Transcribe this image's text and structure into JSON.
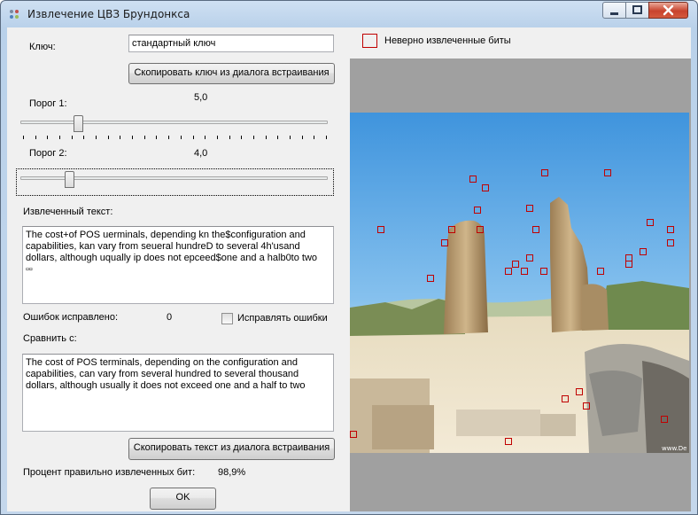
{
  "window": {
    "title": "Извлечение ЦВЗ Брундонкса"
  },
  "key": {
    "label": "Ключ:",
    "value": "стандартный ключ",
    "copy_button": "Скопировать ключ из диалога встраивания"
  },
  "threshold1": {
    "label": "Порог 1:",
    "value_text": "5,0",
    "level": 0.18
  },
  "threshold2": {
    "label": "Порог 2:",
    "value_text": "4,0",
    "level": 0.15
  },
  "extracted": {
    "label": "Извлеченный текст:",
    "text": "The cost+of POS uerminals, depending kn the$configuration and capabilities, kan vary from seueral hundreD to several 4h'usand dollars, although uqually ip does not epceed$one and a halb0to two    ▫▫"
  },
  "errors": {
    "label": "Ошибок исправлено:",
    "value": "0",
    "fix_checkbox_label": "Исправлять ошибки",
    "fix_checked": false
  },
  "compare": {
    "label": "Сравнить с:",
    "text": "The cost of POS terminals, depending on the configuration and capabilities, can vary from several hundred to several thousand dollars, although usually it does not exceed one and a half to two",
    "copy_button": "Скопировать текст из диалога встраивания"
  },
  "percent": {
    "label": "Процент правильно извлеченных бит:",
    "value": "98,9%"
  },
  "ok_button": "OK",
  "legend": {
    "label": "Неверно извлеченные биты",
    "color": "#c00000"
  },
  "image": {
    "watermark": "www.De",
    "marker_color": "#c00000"
  }
}
